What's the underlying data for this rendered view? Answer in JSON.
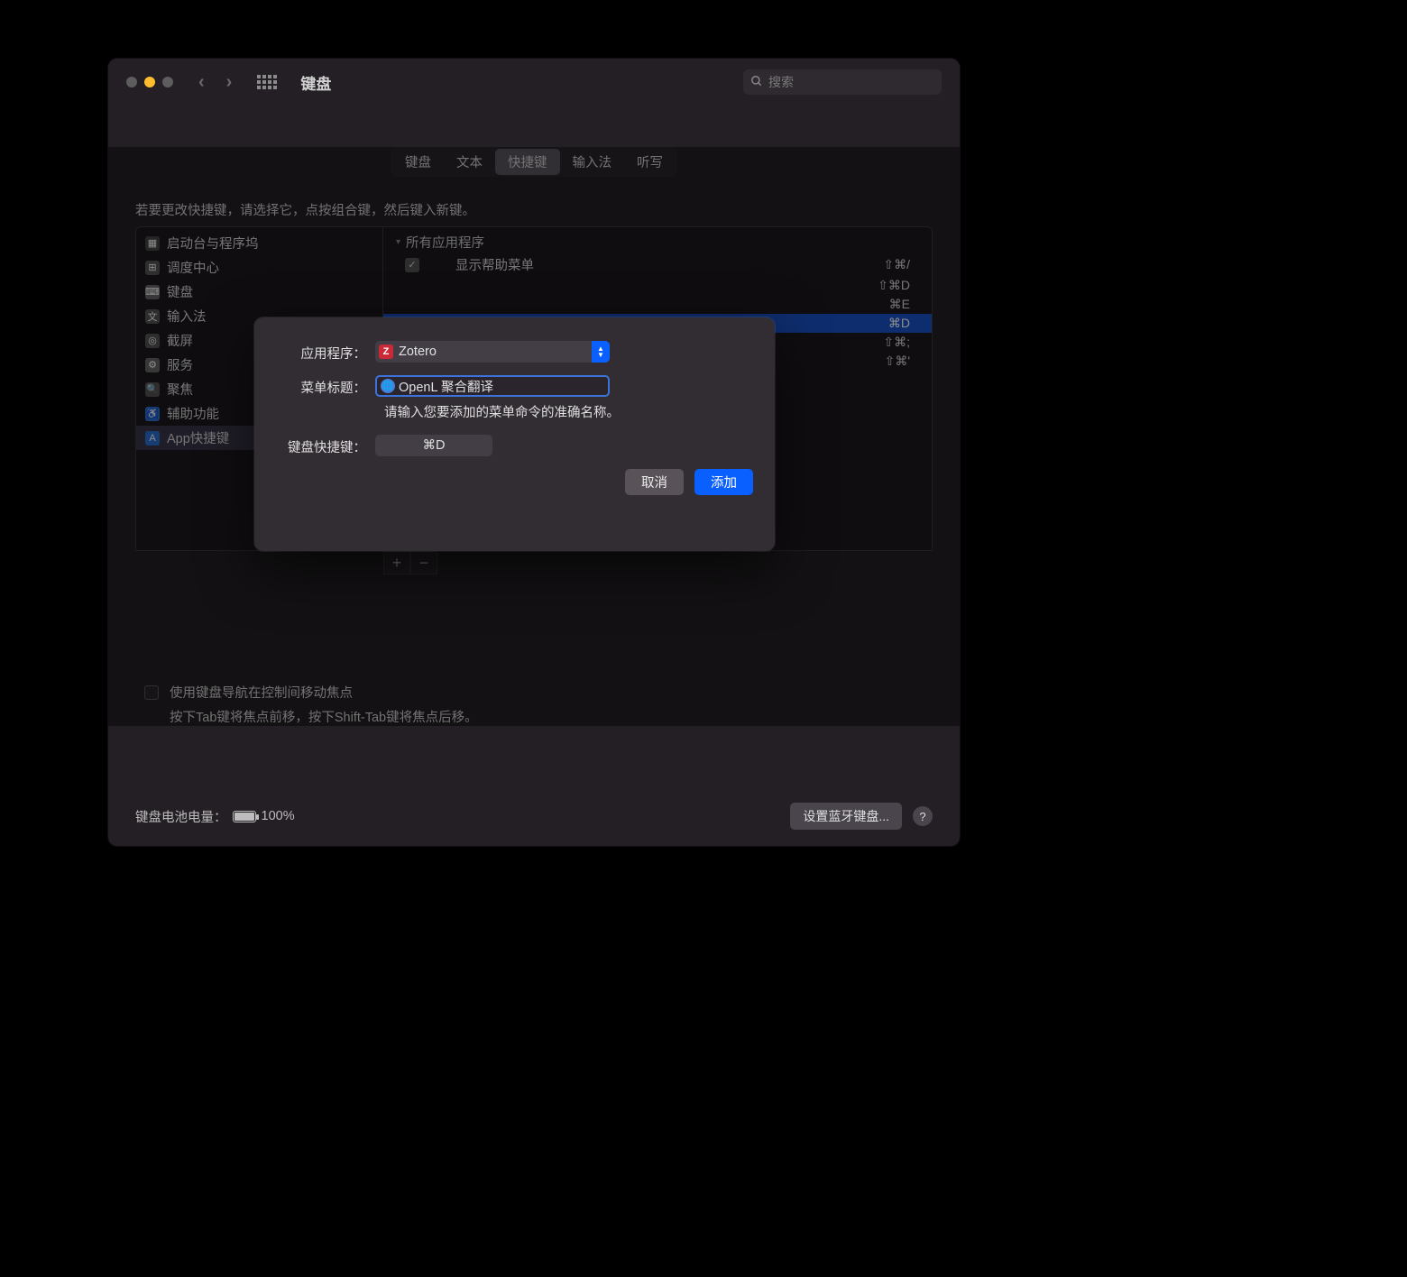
{
  "window": {
    "title": "键盘",
    "search_placeholder": "搜索"
  },
  "tabs": [
    "键盘",
    "文本",
    "快捷键",
    "输入法",
    "听写"
  ],
  "active_tab_index": 2,
  "instruction": "若要更改快捷键，请选择它，点按组合键，然后键入新键。",
  "left_items": [
    {
      "label": "启动台与程序坞"
    },
    {
      "label": "调度中心"
    },
    {
      "label": "键盘"
    },
    {
      "label": "输入法"
    },
    {
      "label": "截屏"
    },
    {
      "label": "服务"
    },
    {
      "label": "聚焦"
    },
    {
      "label": "辅助功能"
    },
    {
      "label": "App快捷键"
    }
  ],
  "left_selected_index": 8,
  "right": {
    "header": "所有应用程序",
    "rows": [
      {
        "checked": true,
        "label": "显示帮助菜单",
        "key": "⇧⌘/"
      },
      {
        "checked": false,
        "label": "",
        "key": "⇧⌘D"
      },
      {
        "checked": false,
        "label": "",
        "key": "⌘E"
      },
      {
        "checked": false,
        "label": "",
        "key": "⌘D",
        "hl": true
      },
      {
        "checked": false,
        "label": "",
        "key": "⇧⌘;"
      },
      {
        "checked": false,
        "label": "",
        "key": "⇧⌘'"
      }
    ]
  },
  "kb_nav_label": "使用键盘导航在控制间移动焦点",
  "kb_nav_hint": "按下Tab键将焦点前移，按下Shift-Tab键将焦点后移。",
  "battery": {
    "label": "键盘电池电量：",
    "pct": "100%"
  },
  "bt_button": "设置蓝牙键盘...",
  "modal": {
    "app_label": "应用程序：",
    "app_value": "Zotero",
    "menu_label": "菜单标题：",
    "menu_value": "OpenL 聚合翻译",
    "menu_hint": "请输入您要添加的菜单命令的准确名称。",
    "sc_label": "键盘快捷键：",
    "sc_value": "⌘D",
    "cancel": "取消",
    "add": "添加"
  }
}
